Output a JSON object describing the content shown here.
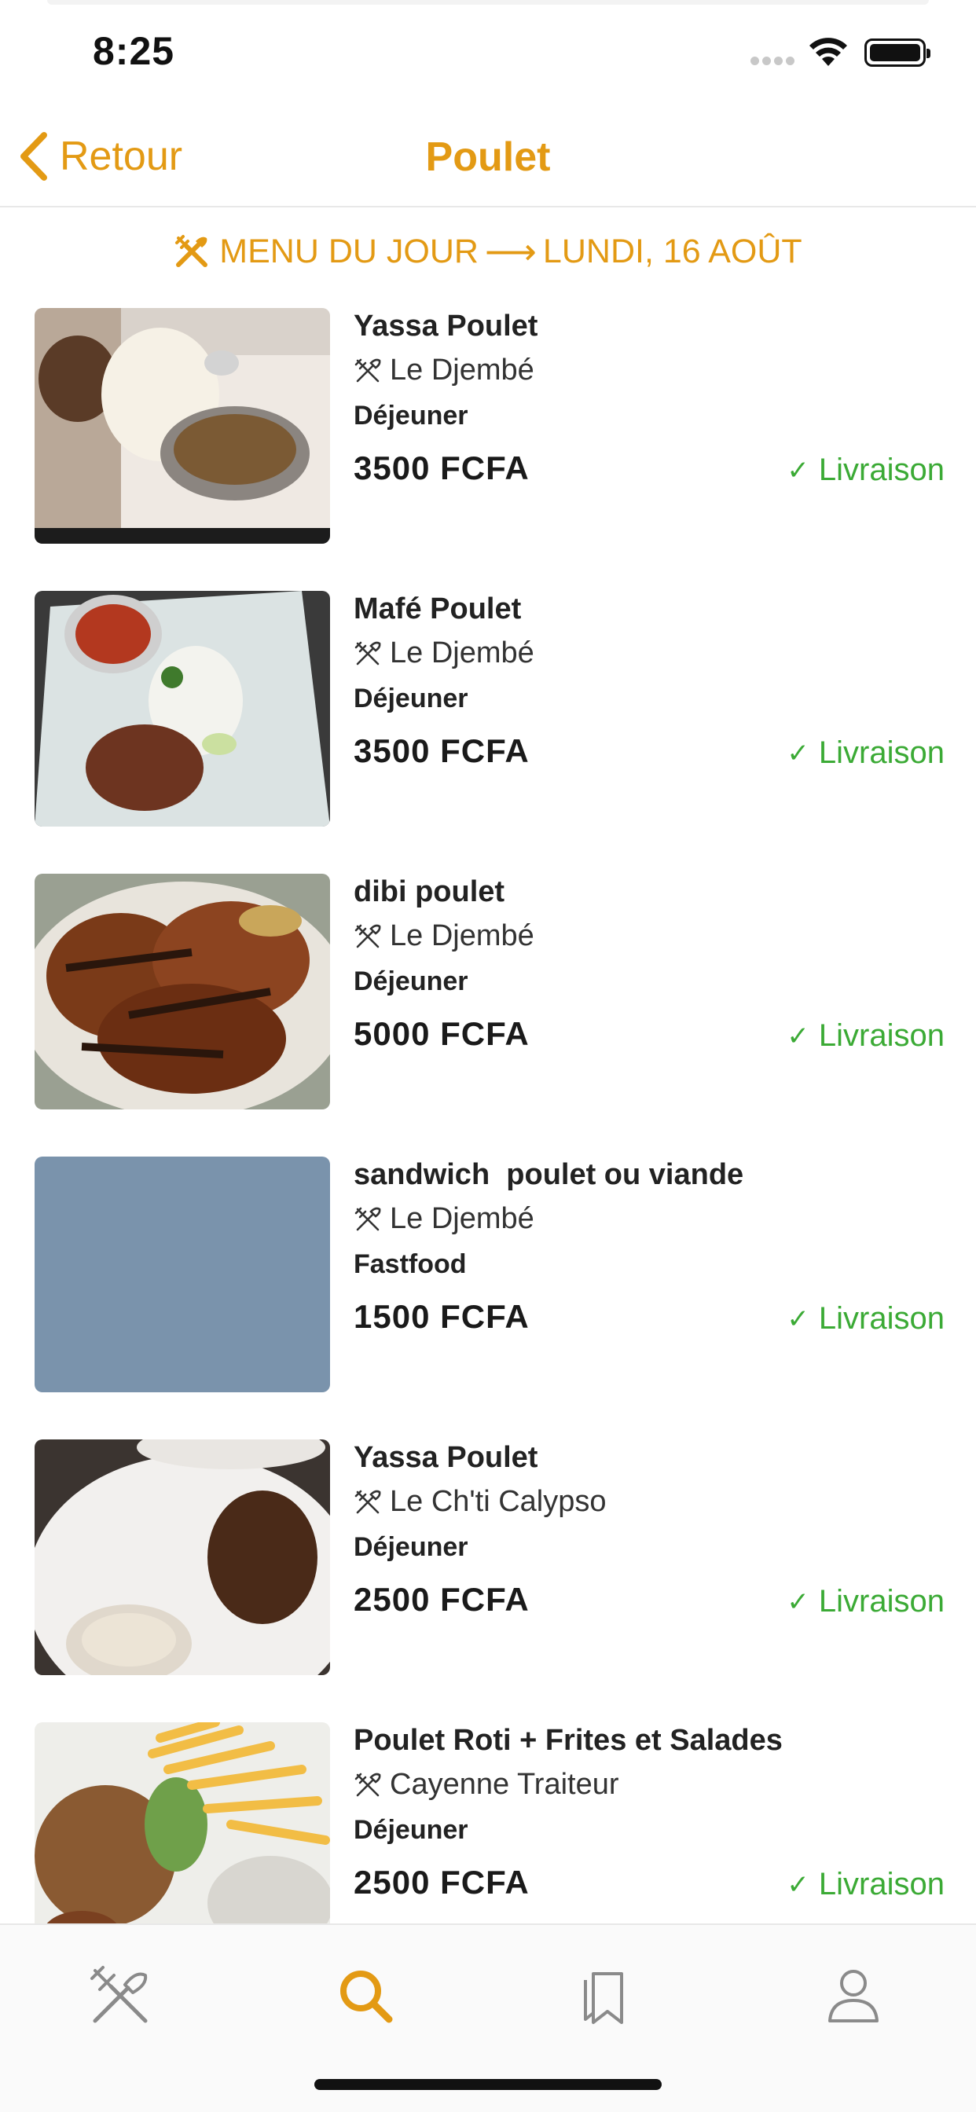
{
  "status_bar": {
    "time": "8:25"
  },
  "nav": {
    "back_label": "Retour",
    "title": "Poulet"
  },
  "section": {
    "prefix": "MENU DU JOUR",
    "date": "LUNDI, 16 AOÛT"
  },
  "items": [
    {
      "name": "Yassa Poulet",
      "restaurant": "Le Djembé",
      "meal": "Déjeuner",
      "price": "3500 FCFA",
      "delivery": "Livraison",
      "photo": "yassa-photo"
    },
    {
      "name": "Mafé Poulet",
      "restaurant": "Le Djembé",
      "meal": "Déjeuner",
      "price": "3500 FCFA",
      "delivery": "Livraison",
      "photo": "mafe-photo"
    },
    {
      "name": "dibi poulet",
      "restaurant": "Le Djembé",
      "meal": "Déjeuner",
      "price": "5000 FCFA",
      "delivery": "Livraison",
      "photo": "dibi-photo"
    },
    {
      "name": "sandwich  poulet ou viande",
      "restaurant": "Le Djembé",
      "meal": "Fastfood",
      "price": "1500 FCFA",
      "delivery": "Livraison",
      "photo": "placeholder"
    },
    {
      "name": "Yassa Poulet",
      "restaurant": "Le Ch'ti Calypso",
      "meal": "Déjeuner",
      "price": "2500 FCFA",
      "delivery": "Livraison",
      "photo": "calypso-photo"
    },
    {
      "name": "Poulet Roti + Frites et Salades",
      "restaurant": "Cayenne Traiteur",
      "meal": "Déjeuner",
      "price": "2500 FCFA",
      "delivery": "Livraison",
      "photo": "roti-photo"
    }
  ],
  "tabs": [
    {
      "icon": "utensils-icon",
      "active": false
    },
    {
      "icon": "search-icon",
      "active": true
    },
    {
      "icon": "bookmarks-icon",
      "active": false
    },
    {
      "icon": "profile-icon",
      "active": false
    }
  ],
  "colors": {
    "accent": "#E39A14",
    "delivery": "#3BAA35",
    "placeholder": "#7A93AC"
  }
}
